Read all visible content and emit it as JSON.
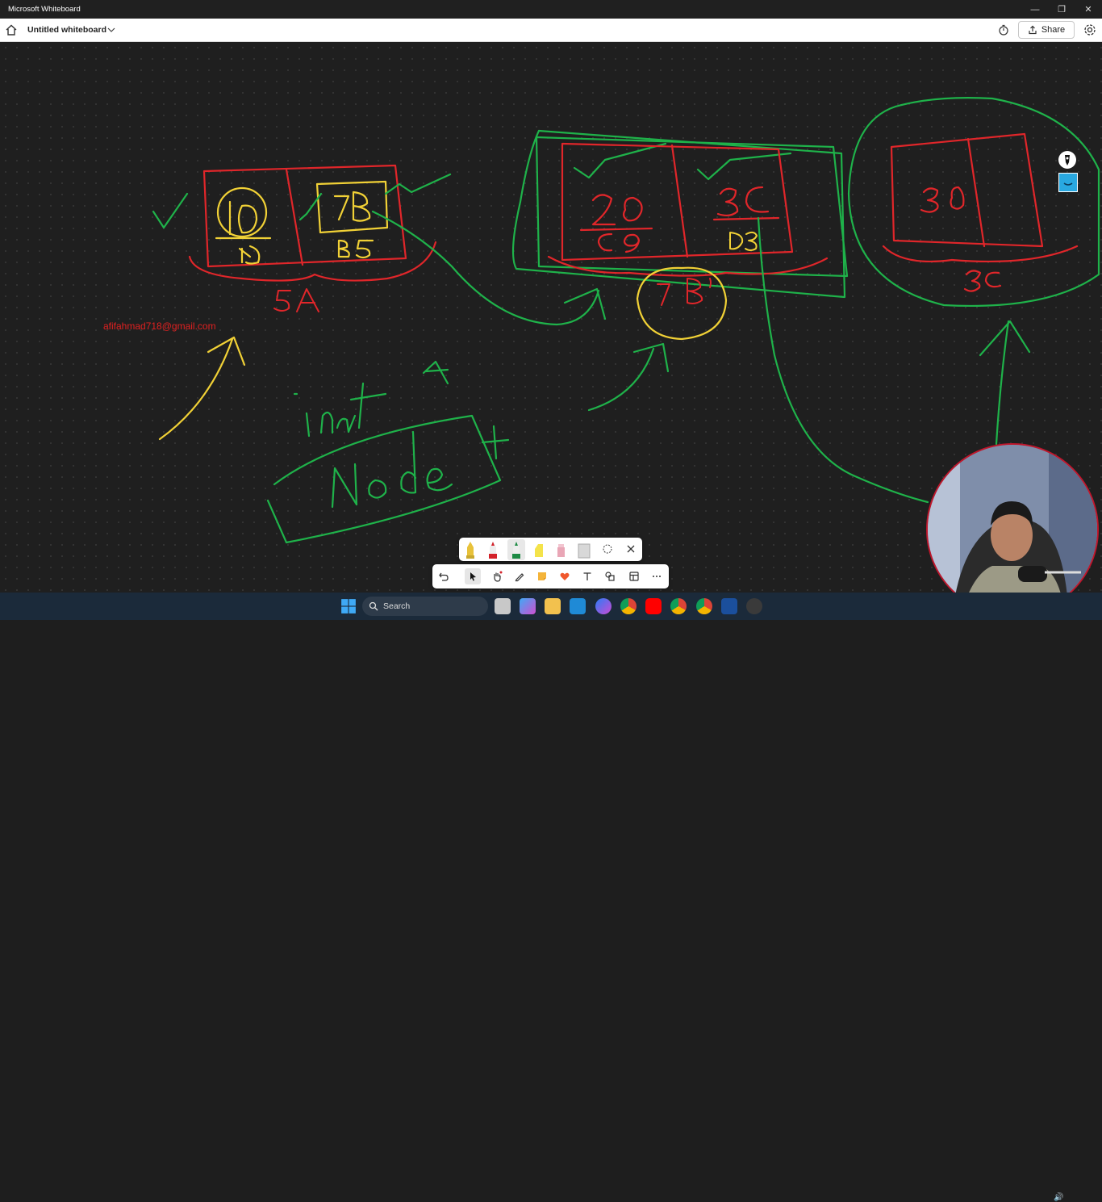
{
  "window": {
    "title": "Microsoft Whiteboard",
    "minimize": "—",
    "restore": "❐",
    "close": "✕"
  },
  "appbar": {
    "board_name": "Untitled whiteboard",
    "share_label": "Share"
  },
  "canvas": {
    "email_text": "afifahmad718@gmail.com",
    "handwriting": {
      "node1_left": "10",
      "node1_left_sub": "1D",
      "node1_right": "7B",
      "node1_right_sub": "B5",
      "node1_label": "5A",
      "node2_left": "20",
      "node2_left_sub": "C9",
      "node2_right": "3C",
      "node2_right_sub": "D3",
      "circled_value": "7B",
      "node3_value": "30",
      "node3_label": "3C",
      "insert_text": "Insert",
      "node_text": "Node"
    },
    "ink_colors": {
      "red": "#e0262a",
      "green": "#1fb24a",
      "yellow": "#f1d136"
    }
  },
  "pen_tray": {
    "items": [
      "pen-yellow",
      "pen-red",
      "pen-green",
      "highlighter-yellow",
      "highlighter-pink",
      "eraser",
      "lasso",
      "close"
    ]
  },
  "toolbar": {
    "tools": [
      "undo",
      "select",
      "hand",
      "pen",
      "sticky-note",
      "reactions",
      "text",
      "shapes",
      "templates",
      "more"
    ]
  },
  "taskbar": {
    "search_label": "Search"
  }
}
